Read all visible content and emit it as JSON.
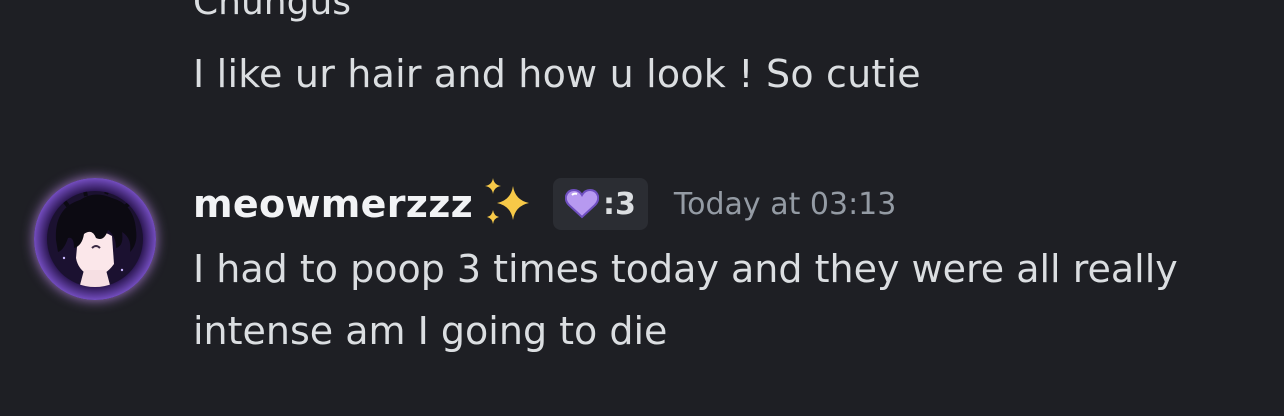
{
  "previous": {
    "author_name": "Chungus",
    "message_text": "I like ur hair and how u look ! So cutie"
  },
  "message": {
    "username": "meowmerzzz",
    "username_decoration_icon": "sparkles-icon",
    "tag": {
      "icon": "purple-heart-icon",
      "label": ":3"
    },
    "timestamp": "Today at 03:13",
    "text": "I had to poop 3 times today and they were all really intense am I going to die"
  },
  "colors": {
    "background": "#1e1f24",
    "text": "#dbdee1",
    "username": "#f2f3f5",
    "timestamp": "#949ba4",
    "tag_background": "#2b2d33",
    "avatar_glow": "#cd96ff"
  }
}
